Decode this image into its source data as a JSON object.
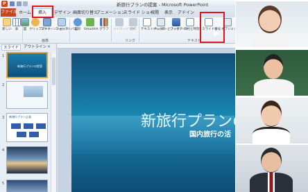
{
  "window": {
    "title": "新旅行プランの提案 - Microsoft PowerPoint"
  },
  "tabs": [
    {
      "label": "ファイル"
    },
    {
      "label": "ホーム"
    },
    {
      "label": "挿入"
    },
    {
      "label": "デザイン"
    },
    {
      "label": "画面切り替え"
    },
    {
      "label": "アニメーション"
    },
    {
      "label": "スライド ショー"
    },
    {
      "label": "校閲"
    },
    {
      "label": "表示"
    },
    {
      "label": "アドイン"
    }
  ],
  "ribbon": {
    "buttons": [
      {
        "label": "新しい"
      },
      {
        "label": "表"
      },
      {
        "label": "図"
      },
      {
        "label": "クリップアート"
      },
      {
        "label": "スクリーンショット"
      },
      {
        "label": "フォトアルバム"
      },
      {
        "label": "図形"
      },
      {
        "label": "SmartArt"
      },
      {
        "label": "グラフ"
      },
      {
        "label": "ハイパーリンク"
      },
      {
        "label": "動作"
      },
      {
        "label": "テキストボックス"
      },
      {
        "label": "ヘッダーとフッター"
      },
      {
        "label": "ワードアート"
      },
      {
        "label": "日付と時刻"
      },
      {
        "label": "スライド番号"
      },
      {
        "label": "オブジェクト"
      }
    ],
    "groups": [
      {
        "label": "表"
      },
      {
        "label": "画像"
      },
      {
        "label": "リンク"
      },
      {
        "label": "テキスト"
      }
    ]
  },
  "left_panel": {
    "tabs": [
      {
        "label": "スライド"
      },
      {
        "label": "アウトライン"
      }
    ],
    "close": "×",
    "thumbnails": [
      {
        "number": "1",
        "title": "新旅行プランの提案"
      },
      {
        "number": "2",
        "title": ""
      },
      {
        "number": "3",
        "title": "新旅行プラン企画"
      },
      {
        "number": "4",
        "title": ""
      },
      {
        "number": "5",
        "title": ""
      }
    ]
  },
  "slide": {
    "title": "新旅行プランの",
    "subtitle": "国内旅行の活"
  },
  "colors": {
    "file_tab": "#c8461c",
    "highlight": "#e0141a",
    "slide_bg": "#1a86b2"
  }
}
